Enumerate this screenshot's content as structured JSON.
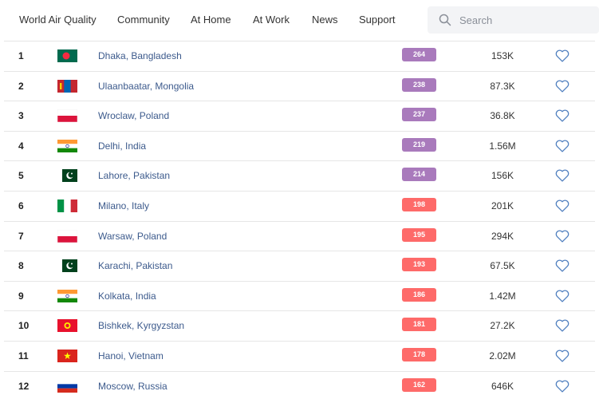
{
  "nav": {
    "items": [
      "World Air Quality",
      "Community",
      "At Home",
      "At Work",
      "News",
      "Support"
    ],
    "search_placeholder": "Search"
  },
  "colors": {
    "purple": "#a97abc",
    "red": "#fe6a69",
    "link": "#3c5a8c"
  },
  "rows": [
    {
      "rank": "1",
      "city": "Dhaka, Bangladesh",
      "aqi": "264",
      "followers": "153K",
      "flag": "bangladesh",
      "level": "purple"
    },
    {
      "rank": "2",
      "city": "Ulaanbaatar, Mongolia",
      "aqi": "238",
      "followers": "87.3K",
      "flag": "mongolia",
      "level": "purple"
    },
    {
      "rank": "3",
      "city": "Wroclaw, Poland",
      "aqi": "237",
      "followers": "36.8K",
      "flag": "poland",
      "level": "purple"
    },
    {
      "rank": "4",
      "city": "Delhi, India",
      "aqi": "219",
      "followers": "1.56M",
      "flag": "india",
      "level": "purple"
    },
    {
      "rank": "5",
      "city": "Lahore, Pakistan",
      "aqi": "214",
      "followers": "156K",
      "flag": "pakistan",
      "level": "purple"
    },
    {
      "rank": "6",
      "city": "Milano, Italy",
      "aqi": "198",
      "followers": "201K",
      "flag": "italy",
      "level": "red"
    },
    {
      "rank": "7",
      "city": "Warsaw, Poland",
      "aqi": "195",
      "followers": "294K",
      "flag": "poland",
      "level": "red"
    },
    {
      "rank": "8",
      "city": "Karachi, Pakistan",
      "aqi": "193",
      "followers": "67.5K",
      "flag": "pakistan",
      "level": "red"
    },
    {
      "rank": "9",
      "city": "Kolkata, India",
      "aqi": "186",
      "followers": "1.42M",
      "flag": "india",
      "level": "red"
    },
    {
      "rank": "10",
      "city": "Bishkek, Kyrgyzstan",
      "aqi": "181",
      "followers": "27.2K",
      "flag": "kyrgyzstan",
      "level": "red"
    },
    {
      "rank": "11",
      "city": "Hanoi, Vietnam",
      "aqi": "178",
      "followers": "2.02M",
      "flag": "vietnam",
      "level": "red"
    },
    {
      "rank": "12",
      "city": "Moscow, Russia",
      "aqi": "162",
      "followers": "646K",
      "flag": "russia",
      "level": "red"
    }
  ]
}
